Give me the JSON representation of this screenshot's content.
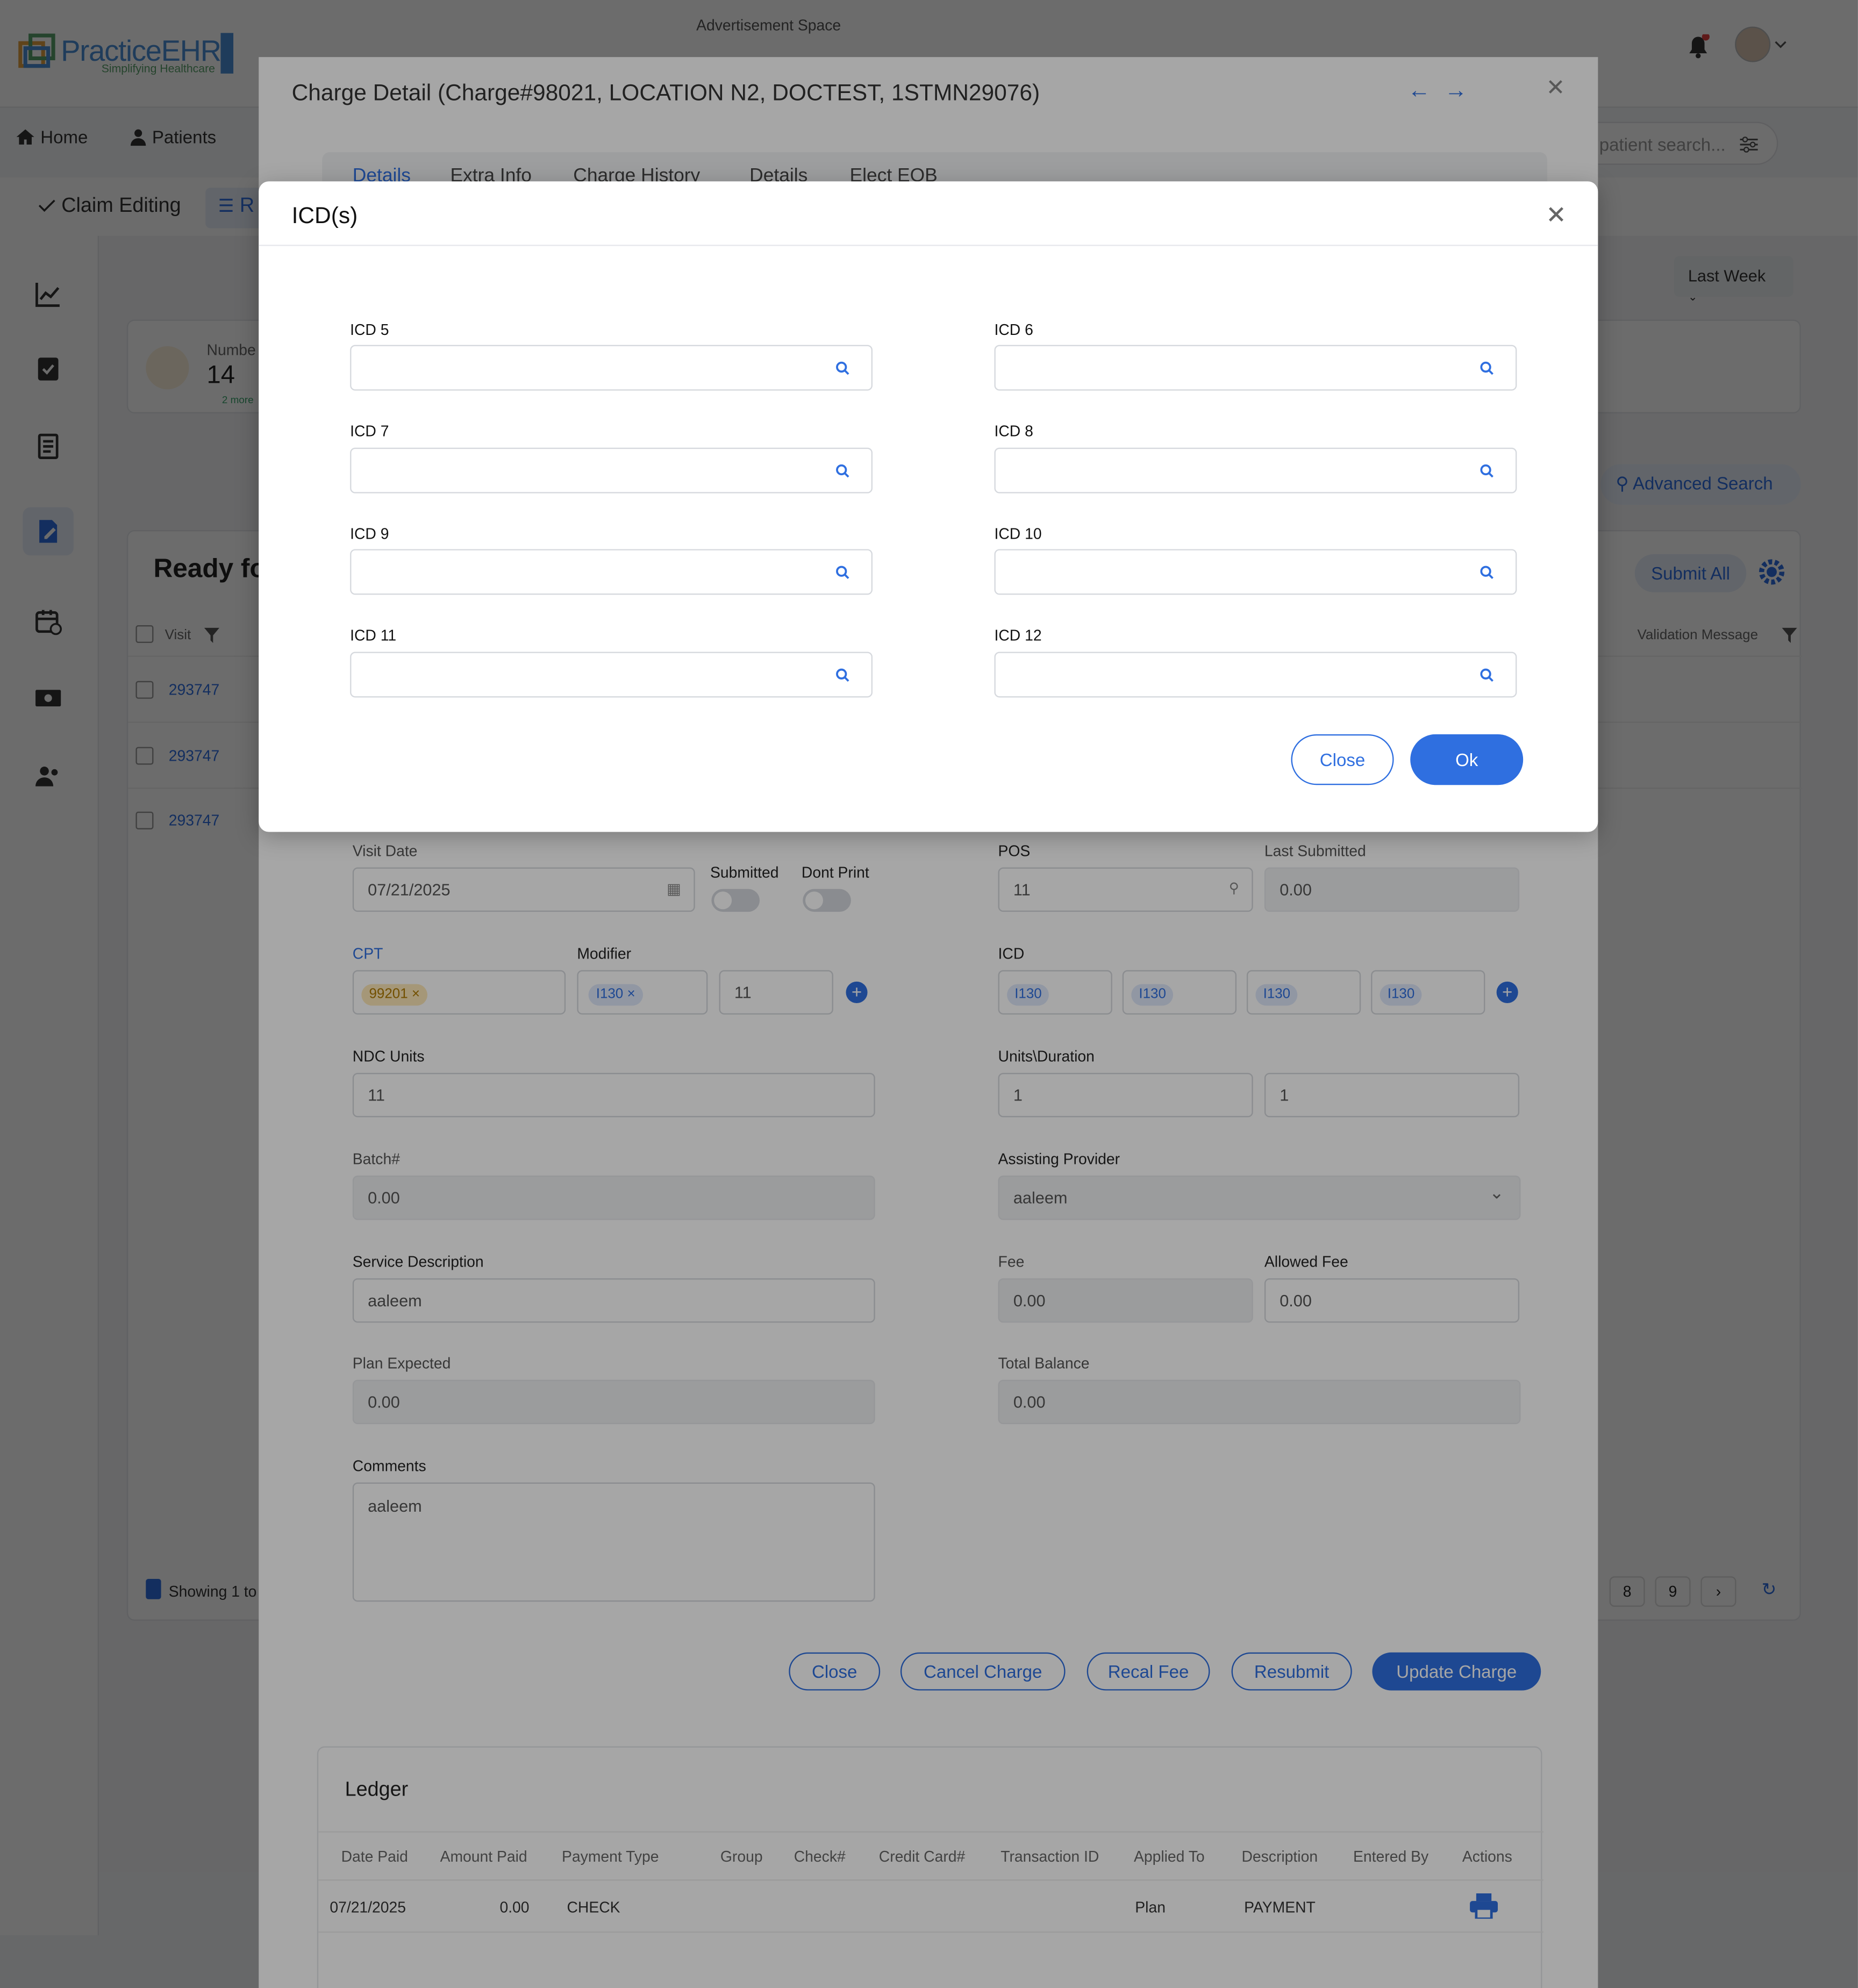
{
  "header": {
    "ad_text": "Advertisement Space",
    "logo_text": "PracticeEHR",
    "logo_sub": "Simplifying Healthcare"
  },
  "nav": {
    "home": "Home",
    "patients": "Patients",
    "patient_search_placeholder": "patient search..."
  },
  "subnav": {
    "claim_editing": "Claim Editing",
    "second_tab": "R"
  },
  "dashboard": {
    "stat_label": "Numbe",
    "stat_value": "14",
    "stat_trend": "2 more",
    "date_filter": "Last Week",
    "advanced_search": "Advanced Search",
    "section_title": "Ready fo",
    "submit_all": "Submit All",
    "visit_col": "Visit",
    "validation_col": "Validation Message",
    "rows": [
      "293747",
      "293747",
      "293747"
    ],
    "showing": "Showing 1 to",
    "pages": [
      "8",
      "9"
    ]
  },
  "charge_modal": {
    "title": "Charge Detail (Charge#98021, LOCATION N2, DOCTEST, 1STMN29076)",
    "tabs": [
      "Details",
      "Extra Info",
      "Charge History",
      "Details",
      "Elect EOB"
    ],
    "visit_date_label": "Visit Date",
    "visit_date": "07/21/2025",
    "submitted_label": "Submitted",
    "dont_print_label": "Dont Print",
    "pos_label": "POS",
    "pos_value": "11",
    "last_submitted_label": "Last Submitted",
    "last_submitted": "0.00",
    "cpt_label": "CPT",
    "cpt_chip": "99201",
    "modifier_label": "Modifier",
    "modifier_chip": "I130",
    "modifier_extra": "11",
    "icd_label": "ICD",
    "icd_chips": [
      "I130",
      "I130",
      "I130",
      "I130"
    ],
    "ndc_label": "NDC Units",
    "ndc_value": "11",
    "units_label": "Units\\Duration",
    "units_value1": "1",
    "units_value2": "1",
    "batch_label": "Batch#",
    "batch_value": "0.00",
    "assist_label": "Assisting Provider",
    "assist_value": "aaleem",
    "service_label": "Service Description",
    "service_value": "aaleem",
    "fee_label": "Fee",
    "fee_value": "0.00",
    "allowed_label": "Allowed Fee",
    "allowed_value": "0.00",
    "plan_label": "Plan Expected",
    "plan_value": "0.00",
    "balance_label": "Total Balance",
    "balance_value": "0.00",
    "comments_label": "Comments",
    "comments_value": "aaleem",
    "buttons": {
      "close": "Close",
      "cancel": "Cancel Charge",
      "recal": "Recal Fee",
      "resubmit": "Resubmit",
      "update": "Update Charge"
    },
    "ledger": {
      "title": "Ledger",
      "headers": [
        "Date Paid",
        "Amount Paid",
        "Payment Type",
        "Group",
        "Check#",
        "Credit Card#",
        "Transaction ID",
        "Applied To",
        "Description",
        "Entered By",
        "Actions"
      ],
      "row": {
        "date": "07/21/2025",
        "amount": "0.00",
        "type": "CHECK",
        "applied": "Plan",
        "description": "PAYMENT"
      }
    }
  },
  "icd_modal": {
    "title": "ICD(s)",
    "fields": [
      {
        "label": "ICD 5",
        "value": ""
      },
      {
        "label": "ICD 6",
        "value": ""
      },
      {
        "label": "ICD 7",
        "value": ""
      },
      {
        "label": "ICD 8",
        "value": ""
      },
      {
        "label": "ICD 9",
        "value": ""
      },
      {
        "label": "ICD 10",
        "value": ""
      },
      {
        "label": "ICD 11",
        "value": ""
      },
      {
        "label": "ICD 12",
        "value": ""
      }
    ],
    "close_label": "Close",
    "ok_label": "Ok"
  },
  "colors": {
    "accent": "#2f6fe0",
    "brand": "#4a90d9"
  }
}
